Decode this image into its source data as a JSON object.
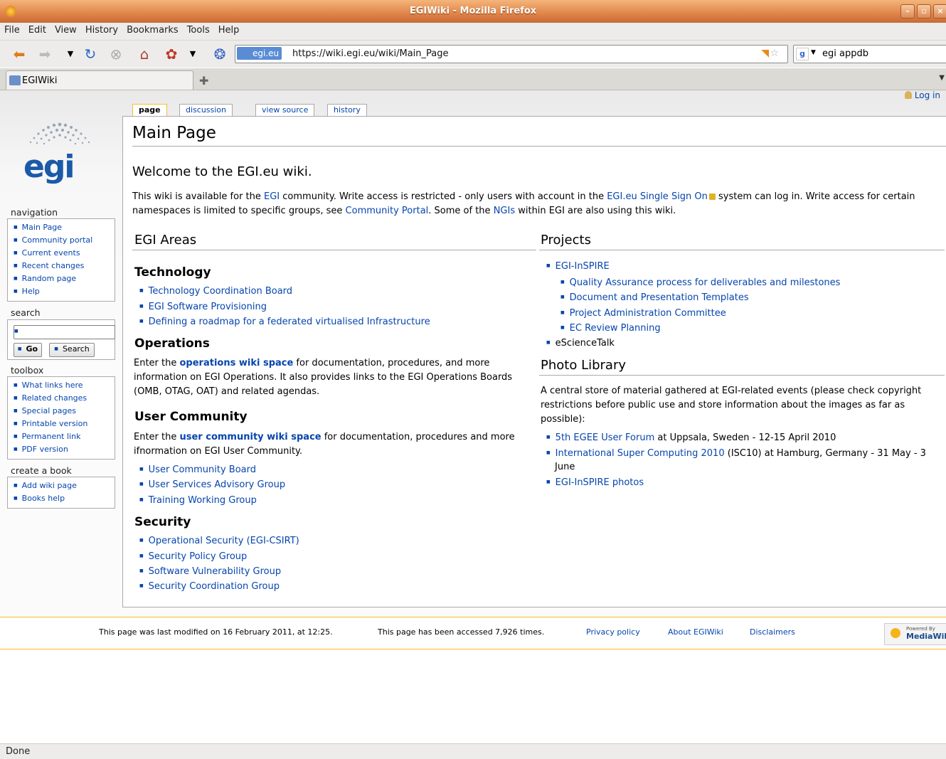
{
  "window": {
    "title": "EGIWiki - Mozilla Firefox"
  },
  "menu": [
    "File",
    "Edit",
    "View",
    "History",
    "Bookmarks",
    "Tools",
    "Help"
  ],
  "urlbar": {
    "site": "egi.eu",
    "url": "https://wiki.egi.eu/wiki/Main_Page"
  },
  "searchbar": {
    "value": "egi appdb"
  },
  "tab": {
    "title": "EGIWiki"
  },
  "login": "Log in",
  "page_tabs": [
    "page",
    "discussion",
    "view source",
    "history"
  ],
  "sidebar": {
    "navigation": {
      "heading": "navigation",
      "items": [
        "Main Page",
        "Community portal",
        "Current events",
        "Recent changes",
        "Random page",
        "Help"
      ]
    },
    "search": {
      "heading": "search",
      "go": "Go",
      "search": "Search"
    },
    "toolbox": {
      "heading": "toolbox",
      "items": [
        "What links here",
        "Related changes",
        "Special pages",
        "Printable version",
        "Permanent link",
        "PDF version"
      ]
    },
    "book": {
      "heading": "create a book",
      "items": [
        "Add wiki page",
        "Books help"
      ]
    }
  },
  "main": {
    "title": "Main Page",
    "welcome": "Welcome to the EGI.eu wiki.",
    "intro": {
      "t1": "This wiki is available for the ",
      "l1": "EGI",
      "t2": " community. Write access is restricted - only users with account in the ",
      "l2": "EGI.eu Single Sign On",
      "t3": " system can log in. Write access for certain",
      "t4": "namespaces is limited to specific groups, see ",
      "l3": "Community Portal",
      "t5": ". Some of the ",
      "l4": "NGIs",
      "t6": " within EGI are also using this wiki."
    },
    "areas": {
      "heading": "EGI Areas",
      "technology": {
        "heading": "Technology",
        "items": [
          "Technology Coordination Board",
          "EGI Software Provisioning",
          "Defining a roadmap for a federated virtualised Infrastructure"
        ]
      },
      "operations": {
        "heading": "Operations",
        "t1": "Enter the ",
        "link": "operations wiki space",
        "t2": " for documentation, procedures, and more",
        "line2": "information on EGI Operations. It also provides links to the EGI Operations Boards",
        "line3": "(OMB, OTAG, OAT) and related agendas."
      },
      "user_community": {
        "heading": "User Community",
        "t1": "Enter the ",
        "link": "user community wiki space",
        "t2": " for documentation, procedures and more",
        "line2": "ifnormation on EGI User Community.",
        "items": [
          "User Community Board",
          "User Services Advisory Group",
          "Training Working Group"
        ]
      },
      "security": {
        "heading": "Security",
        "items": [
          "Operational Security (EGI-CSIRT)",
          "Security Policy Group",
          "Software Vulnerability Group",
          "Security Coordination Group"
        ]
      }
    },
    "projects": {
      "heading": "Projects",
      "top": "EGI-InSPIRE",
      "sub": [
        "Quality Assurance process for deliverables and milestones",
        "Document and Presentation Templates",
        "Project Administration Committee",
        "EC Review Planning"
      ],
      "other": "eScienceTalk"
    },
    "photo": {
      "heading": "Photo Library",
      "line1": "A central store of material gathered at EGI-related events (please check copyright",
      "line2": "restrictions before public use and store information about the images as far as",
      "line3": "possible):",
      "i1_link": "5th EGEE User Forum",
      "i1_text": " at Uppsala, Sweden - 12-15 April 2010",
      "i2_link": "International Super Computing 2010",
      "i2_text": " (ISC10) at Hamburg, Germany - 31 May - 3",
      "i2_line2": "June",
      "i3_link": "EGI-InSPIRE photos"
    }
  },
  "footer": {
    "modified": "This page was last modified on 16 February 2011, at 12:25.",
    "accessed": "This page has been accessed 7,926 times.",
    "privacy": "Privacy policy",
    "about": "About EGIWiki",
    "disclaimers": "Disclaimers",
    "badge_small": "Powered By",
    "badge": "MediaWiki"
  },
  "status": "Done"
}
